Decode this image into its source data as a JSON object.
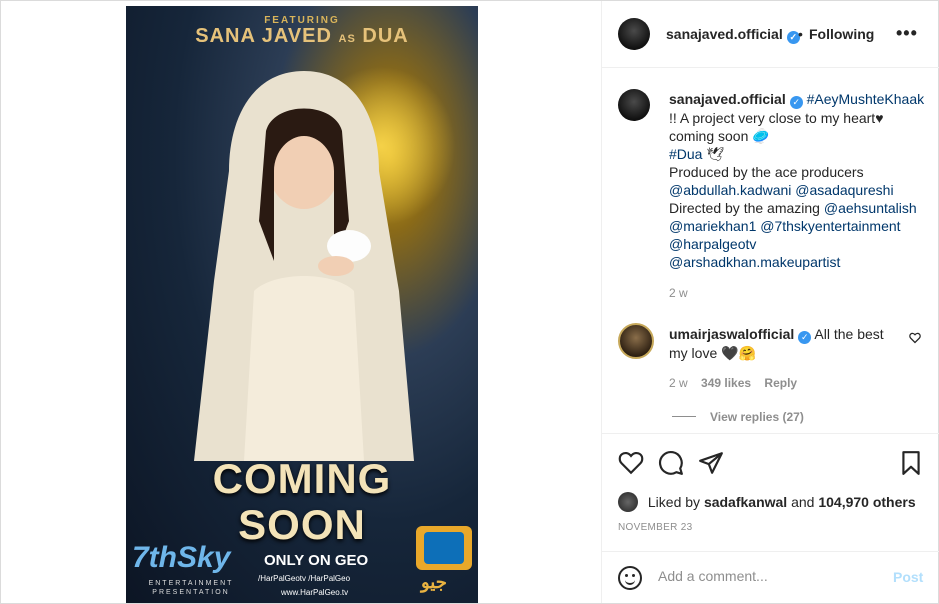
{
  "poster": {
    "featuring": "FEATURING",
    "star": "SANA JAVED",
    "as": "AS",
    "role": "DUA",
    "coming": "COMING",
    "soon": "SOON",
    "brand": "7thSky",
    "brand_sub": "ENTERTAINMENT PRESENTATION",
    "only_on": "ONLY ON GEO",
    "social": "/HarPalGeotv  /HarPalGeo",
    "url": "www.HarPalGeo.tv",
    "geo_urdu": "جیو"
  },
  "header": {
    "username": "sanajaved.official",
    "verified": "✓",
    "dot": "•",
    "follow_label": "Following",
    "more": "•••"
  },
  "caption": {
    "username": "sanajaved.official",
    "hashtag": "#AeyMushteKhaak",
    "line1": "!! A project very close to my heart♥",
    "line2": "coming soon 🥏",
    "line3_tag": "#Dua",
    "line3_emoji": "🕊",
    "line4": "Produced by the ace producers",
    "line5": "@abdullah.kadwani @asadaqureshi",
    "line6_pre": "Directed by the amazing ",
    "line6_tag": "@aehsuntalish",
    "line7": "@mariekhan1 @7thskyentertainment",
    "line8": "@harpalgeotv",
    "line9": "@arshadkhan.makeupartist",
    "time": "2 w"
  },
  "comment": {
    "username": "umairjaswalofficial",
    "text": "All the best",
    "text2": "my love 🖤🤗",
    "time": "2 w",
    "likes": "349 likes",
    "reply": "Reply",
    "view_replies": "View replies (27)"
  },
  "likes": {
    "prefix": "Liked by",
    "user": "sadafkanwal",
    "and": "and",
    "count": "104,970 others"
  },
  "date": "NOVEMBER 23",
  "add_comment": {
    "placeholder": "Add a comment...",
    "post_label": "Post"
  },
  "colors": {
    "link": "#00376b",
    "verified": "#3897f0",
    "muted": "#8e8e8e",
    "post_disabled": "#b2dffc"
  },
  "icons": [
    "heart-icon",
    "comment-icon",
    "share-icon",
    "bookmark-icon",
    "emoji-icon",
    "more-icon"
  ]
}
